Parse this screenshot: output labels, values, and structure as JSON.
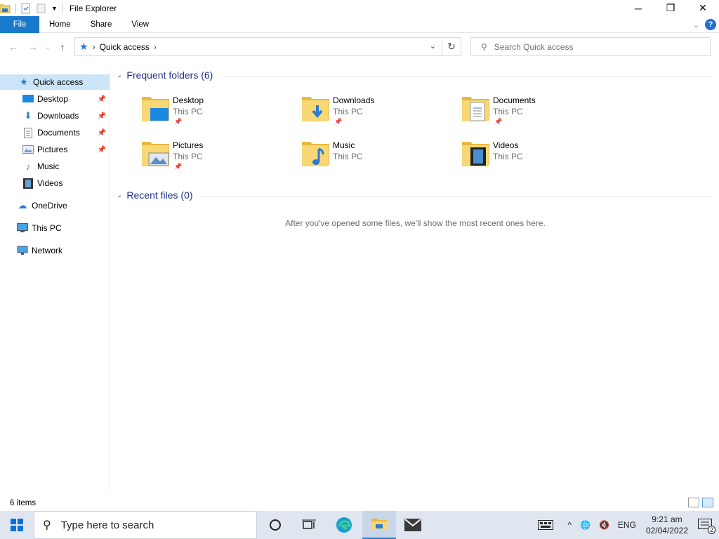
{
  "window": {
    "title": "File Explorer",
    "minimize_label": "─",
    "restore_label": "❐",
    "close_label": "✕"
  },
  "ribbon": {
    "tabs": [
      {
        "label": "File"
      },
      {
        "label": "Home"
      },
      {
        "label": "Share"
      },
      {
        "label": "View"
      }
    ],
    "help_label": "?"
  },
  "navigation": {
    "back_icon": "←",
    "forward_icon": "→",
    "recent_icon": "⌄",
    "up_icon": "↑",
    "breadcrumb": [
      "Quick access"
    ],
    "refresh_icon": "↻"
  },
  "search": {
    "placeholder": "Search Quick access"
  },
  "sidebar": {
    "items": [
      {
        "label": "Quick access",
        "icon": "star-icon",
        "selected": true
      },
      {
        "label": "Desktop",
        "icon": "desktop-icon",
        "pinned": true
      },
      {
        "label": "Downloads",
        "icon": "download-icon",
        "pinned": true
      },
      {
        "label": "Documents",
        "icon": "document-icon",
        "pinned": true
      },
      {
        "label": "Pictures",
        "icon": "picture-icon",
        "pinned": true
      },
      {
        "label": "Music",
        "icon": "music-icon",
        "pinned": false
      },
      {
        "label": "Videos",
        "icon": "video-icon",
        "pinned": false
      },
      {
        "label": "OneDrive",
        "icon": "cloud-icon"
      },
      {
        "label": "This PC",
        "icon": "computer-icon"
      },
      {
        "label": "Network",
        "icon": "network-icon"
      }
    ]
  },
  "main": {
    "frequent_folders": {
      "heading": "Frequent folders (6)",
      "folders": [
        {
          "name": "Desktop",
          "location": "This PC",
          "pinned": true,
          "icon": "desktop-folder-icon"
        },
        {
          "name": "Downloads",
          "location": "This PC",
          "pinned": true,
          "icon": "downloads-folder-icon"
        },
        {
          "name": "Documents",
          "location": "This PC",
          "pinned": true,
          "icon": "documents-folder-icon"
        },
        {
          "name": "Pictures",
          "location": "This PC",
          "pinned": true,
          "icon": "pictures-folder-icon"
        },
        {
          "name": "Music",
          "location": "This PC",
          "pinned": false,
          "icon": "music-folder-icon"
        },
        {
          "name": "Videos",
          "location": "This PC",
          "pinned": false,
          "icon": "videos-folder-icon"
        }
      ]
    },
    "recent_files": {
      "heading": "Recent files (0)",
      "empty_message": "After you've opened some files, we'll show the most recent ones here."
    }
  },
  "statusbar": {
    "item_count": "6 items"
  },
  "taskbar": {
    "search_placeholder": "Type here to search",
    "tray": {
      "language": "ENG",
      "time": "9:21 am",
      "date": "02/04/2022",
      "notification_count": "2"
    }
  },
  "colors": {
    "accent": "#1979ca",
    "section_heading": "#1e3287",
    "selection": "#cce4f7",
    "taskbar": "#dfe6ef",
    "folder_yellow": "#f8d775"
  }
}
